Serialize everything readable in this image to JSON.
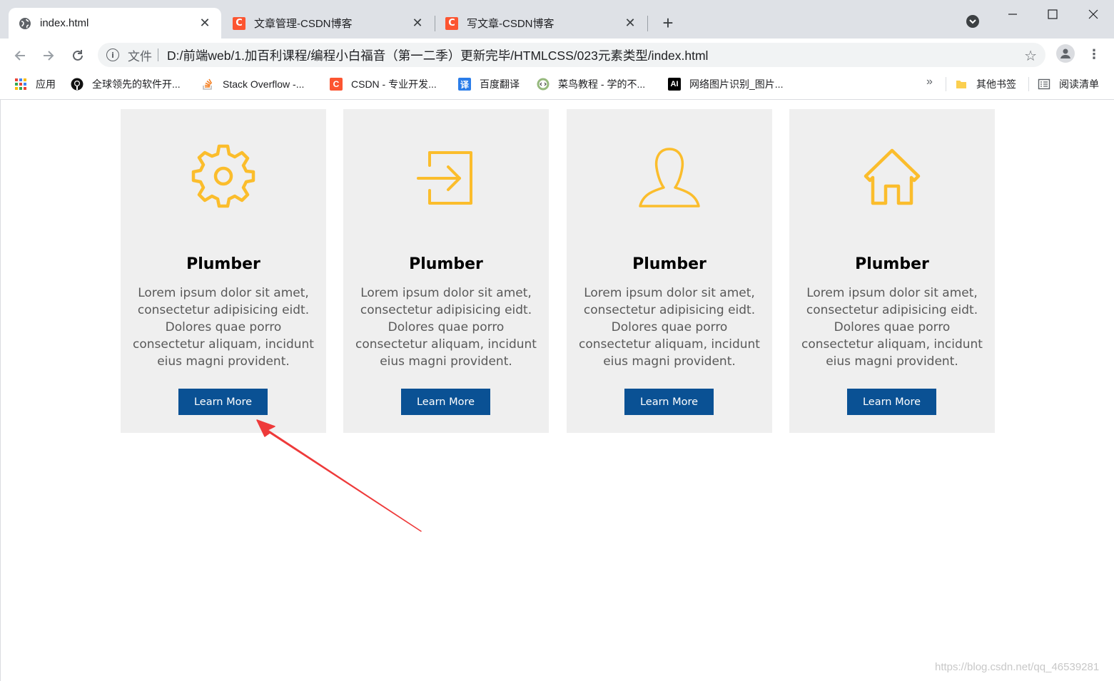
{
  "browser": {
    "tabs": [
      {
        "label": "index.html",
        "icon": "globe-icon",
        "active": true
      },
      {
        "label": "文章管理-CSDN博客",
        "icon": "csdn-icon",
        "active": false
      },
      {
        "label": "写文章-CSDN博客",
        "icon": "csdn-icon",
        "active": false
      }
    ],
    "csdn_glyph": "C",
    "close_glyph": "✕",
    "new_tab_glyph": "+",
    "address": {
      "scheme_label": "文件",
      "url": "D:/前端web/1.加百利课程/编程小白福音（第一二季）更新完毕/HTMLCSS/023元素类型/index.html"
    },
    "bookmarks": [
      {
        "label": "应用",
        "icon": "apps-grid-icon"
      },
      {
        "label": "全球领先的软件开...",
        "icon": "github-icon"
      },
      {
        "label": "Stack Overflow -...",
        "icon": "stackoverflow-icon"
      },
      {
        "label": "CSDN - 专业开发...",
        "icon": "csdn-icon"
      },
      {
        "label": "百度翻译",
        "icon": "baidu-translate-icon",
        "glyph": "译"
      },
      {
        "label": "菜鸟教程 - 学的不...",
        "icon": "runoob-icon"
      },
      {
        "label": "网络图片识别_图片...",
        "icon": "ai-icon",
        "glyph": "AI"
      },
      {
        "label": "其他书签",
        "icon": "folder-icon"
      },
      {
        "label": "阅读清单",
        "icon": "reading-list-icon"
      }
    ],
    "overflow_label": "»"
  },
  "cards": [
    {
      "icon": "gear-icon",
      "title": "Plumber",
      "text": "Lorem ipsum dolor sit amet, consectetur adipisicing eidt. Dolores quae porro consectetur aliquam, incidunt eius magni provident.",
      "button": "Learn More"
    },
    {
      "icon": "sign-in-icon",
      "title": "Plumber",
      "text": "Lorem ipsum dolor sit amet, consectetur adipisicing eidt. Dolores quae porro consectetur aliquam, incidunt eius magni provident.",
      "button": "Learn More"
    },
    {
      "icon": "user-icon",
      "title": "Plumber",
      "text": "Lorem ipsum dolor sit amet, consectetur adipisicing eidt. Dolores quae porro consectetur aliquam, incidunt eius magni provident.",
      "button": "Learn More"
    },
    {
      "icon": "home-icon",
      "title": "Plumber",
      "text": "Lorem ipsum dolor sit amet, consectetur adipisicing eidt. Dolores quae porro consectetur aliquam, incidunt eius magni provident.",
      "button": "Learn More"
    }
  ],
  "colors": {
    "icon_accent": "#fbbd2c",
    "button_bg": "#0a5194",
    "card_bg": "#efefef",
    "annotation_arrow": "#ee3a3a"
  },
  "watermark": "https://blog.csdn.net/qq_46539281"
}
